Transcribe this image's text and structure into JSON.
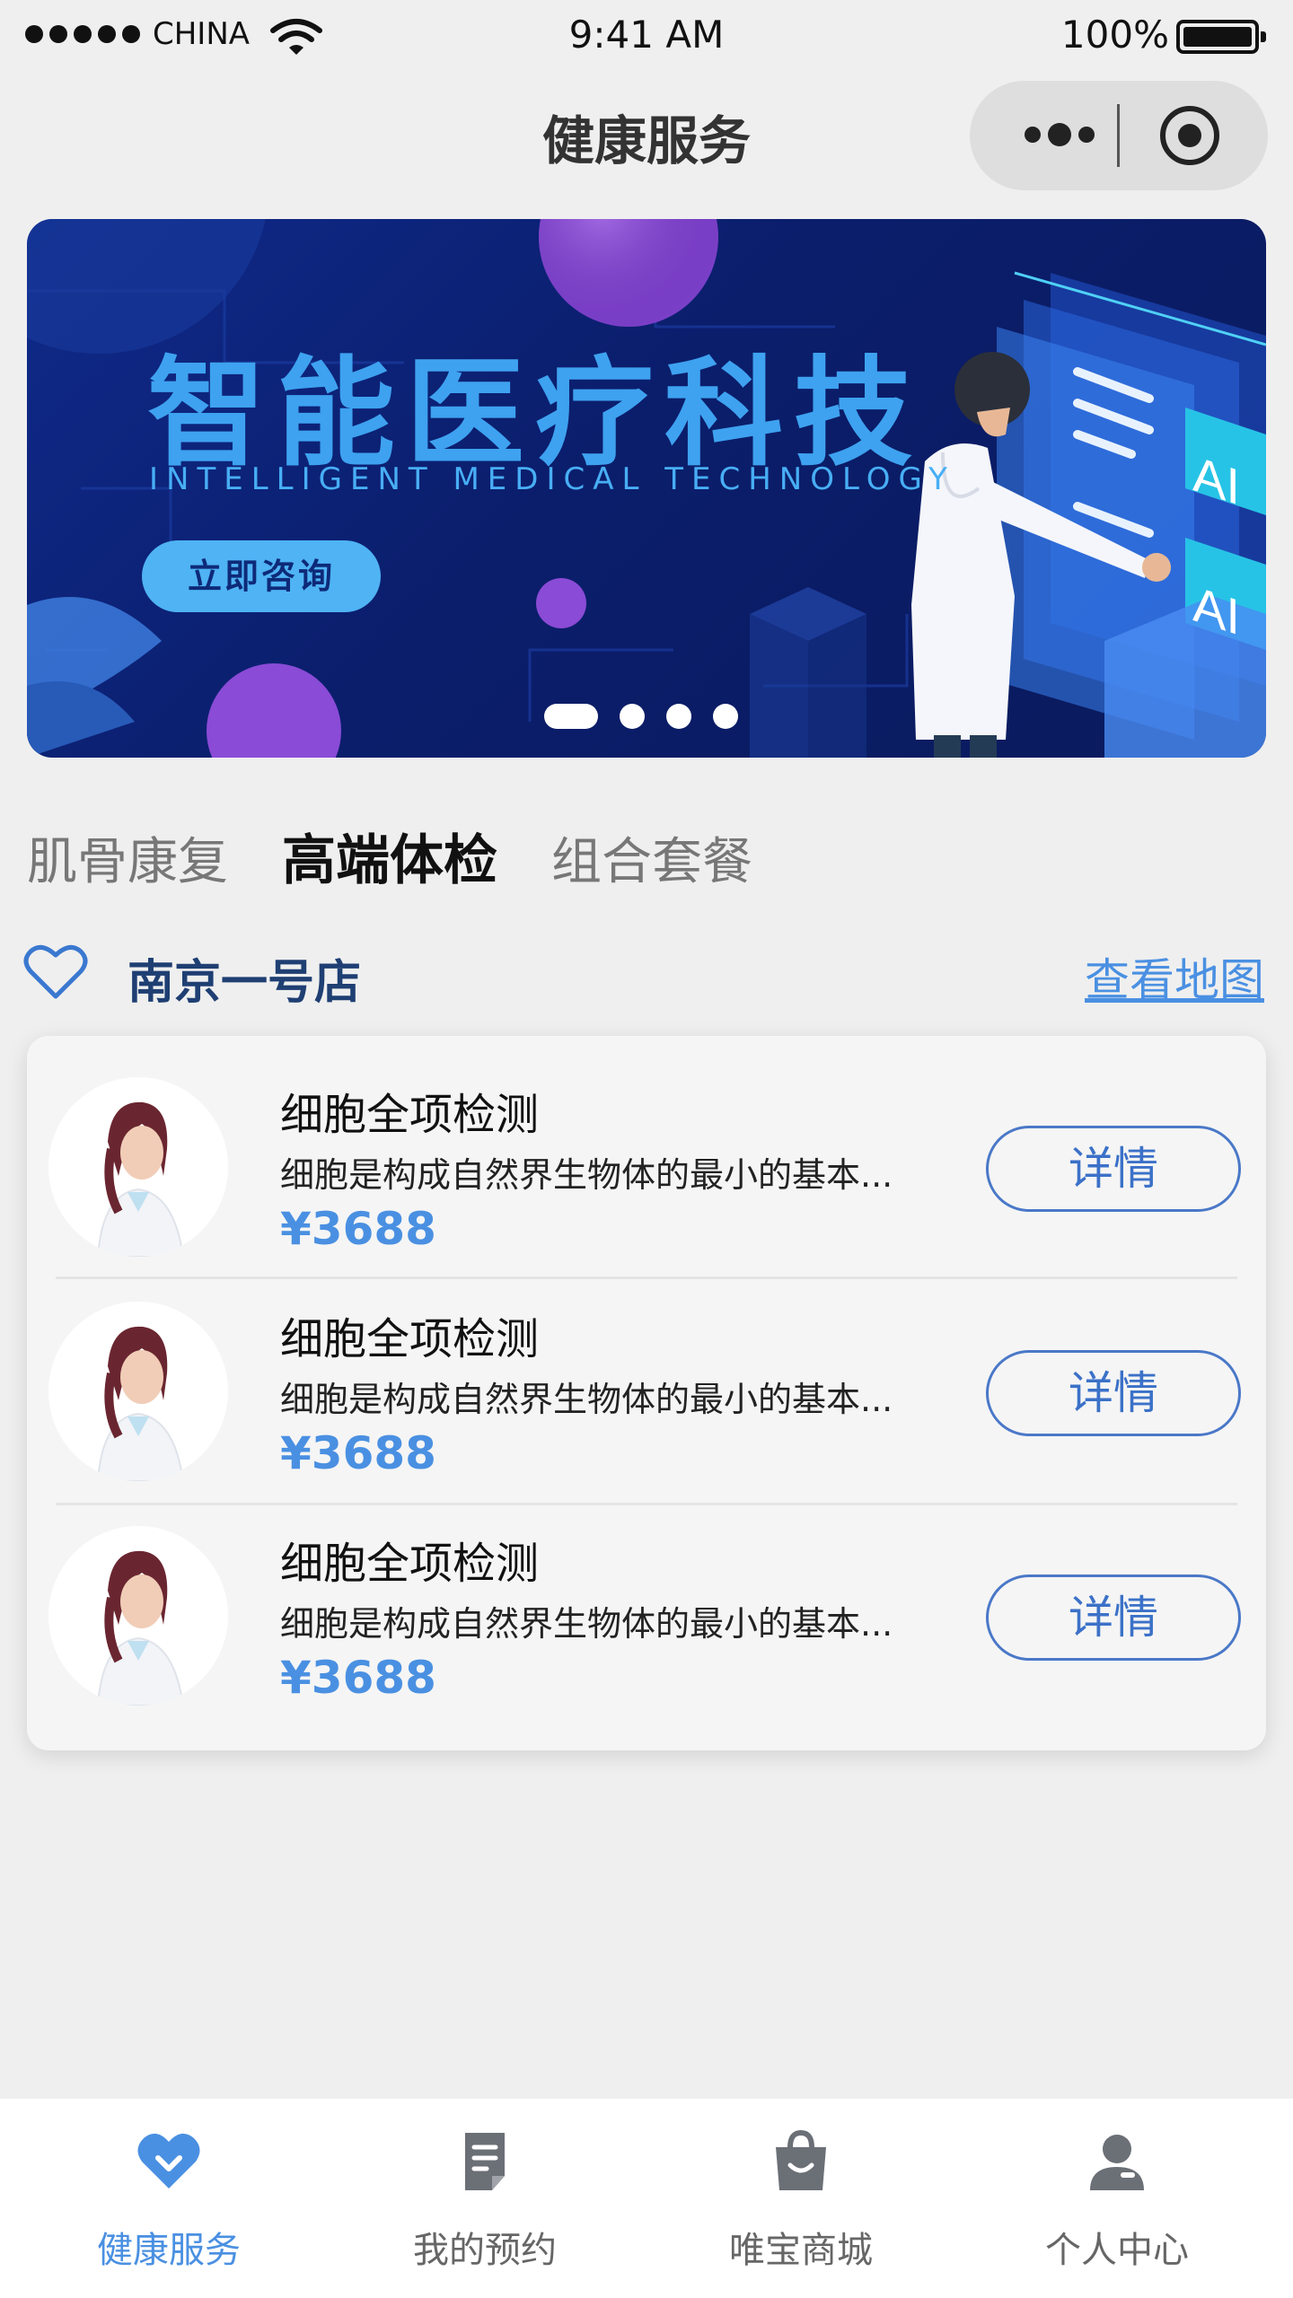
{
  "status_bar": {
    "carrier": "CHINA",
    "time": "9:41 AM",
    "battery": "100%",
    "battery_level": 1.0
  },
  "nav": {
    "title": "健康服务",
    "more_icon": "more-dots-icon",
    "close_icon": "target-circle-icon"
  },
  "banner": {
    "title": "智能医疗科技",
    "subtitle": "INTELLIGENT MEDICAL TECHNOLOGY",
    "button": "立即咨询",
    "illustration_label_1": "AI",
    "illustration_label_2": "AI",
    "pages": 4,
    "active_page": 1
  },
  "category_tabs": [
    {
      "label": "肌骨康复",
      "active": false
    },
    {
      "label": "高端体检",
      "active": true
    },
    {
      "label": "组合套餐",
      "active": false
    }
  ],
  "store": {
    "icon": "heart-outline-icon",
    "name": "南京一号店",
    "map_link": "查看地图"
  },
  "items": [
    {
      "title": "细胞全项检测",
      "desc": "细胞是构成自然界生物体的最小的基本...",
      "price": "¥3688",
      "button": "详情"
    },
    {
      "title": "细胞全项检测",
      "desc": "细胞是构成自然界生物体的最小的基本...",
      "price": "¥3688",
      "button": "详情"
    },
    {
      "title": "细胞全项检测",
      "desc": "细胞是构成自然界生物体的最小的基本...",
      "price": "¥3688",
      "button": "详情"
    }
  ],
  "tabbar": [
    {
      "label": "健康服务",
      "icon": "heart-shield-icon",
      "active": true
    },
    {
      "label": "我的预约",
      "icon": "document-icon",
      "active": false
    },
    {
      "label": "唯宝商城",
      "icon": "shopping-bag-icon",
      "active": false
    },
    {
      "label": "个人中心",
      "icon": "user-icon",
      "active": false
    }
  ],
  "colors": {
    "accent": "#4a90e2",
    "banner_bg": "#0b1e6c",
    "banner_text": "#3ea2f0",
    "store_name": "#1f3f73"
  }
}
